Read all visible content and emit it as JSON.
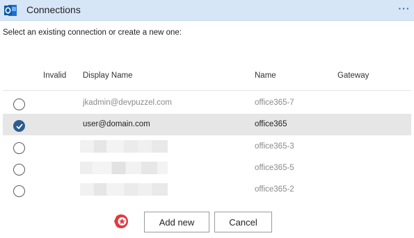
{
  "header": {
    "title": "Connections",
    "app_icon": "outlook-icon",
    "more_label": "···"
  },
  "instructions": "Select an existing connection or create a new one:",
  "table": {
    "columns": [
      "Invalid",
      "Display Name",
      "Name",
      "Gateway"
    ],
    "rows": [
      {
        "selected": false,
        "display_name": "jkadmin@devpuzzel.com",
        "name": "office365-7",
        "gateway": ""
      },
      {
        "selected": true,
        "display_name": "user@domain.com",
        "name": "office365",
        "gateway": ""
      },
      {
        "selected": false,
        "display_name": "",
        "name": "office365-3",
        "gateway": ""
      },
      {
        "selected": false,
        "display_name": "",
        "name": "office365-5",
        "gateway": ""
      },
      {
        "selected": false,
        "display_name": "",
        "name": "office365-2",
        "gateway": ""
      }
    ]
  },
  "buttons": {
    "add_new": "Add new",
    "cancel": "Cancel"
  },
  "colors": {
    "header_bg": "#d7e6f7",
    "accent": "#2e5c8f",
    "badge": "#e0393e"
  }
}
